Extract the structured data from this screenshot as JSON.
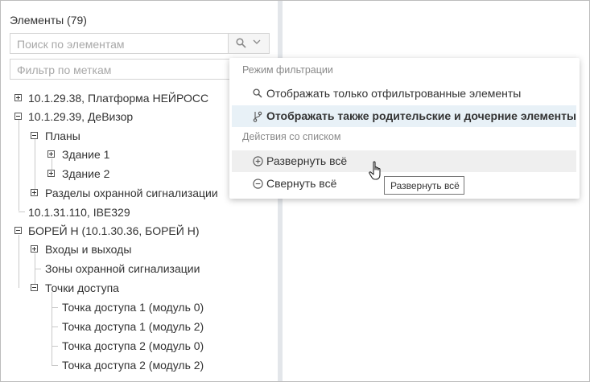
{
  "panel": {
    "header": "Элементы (79)",
    "search_placeholder": "Поиск по элементам",
    "filter_placeholder": "Фильтр по меткам"
  },
  "tree": {
    "n1": "10.1.29.38, Платформа НЕЙРОСС",
    "n2": "10.1.29.39, ДеВизор",
    "n3": "Планы",
    "n4": "Здание 1",
    "n5": "Здание 2",
    "n6": "Разделы охранной сигнализации",
    "n7": "10.1.31.110, IBE329",
    "n8": "БОРЕЙ Н (10.1.30.36, БОРЕЙ Н)",
    "n9": "Входы и выходы",
    "n10": "Зоны охранной сигнализации",
    "n11": "Точки доступа",
    "n12": "Точка доступа 1 (модуль 0)",
    "n13": "Точка доступа 1 (модуль 2)",
    "n14": "Точка доступа 2 (модуль 0)",
    "n15": "Точка доступа 2 (модуль 2)"
  },
  "menu": {
    "section_filter": "Режим фильтрации",
    "item_only_filtered": "Отображать только отфильтрованные элементы",
    "item_parent_child": "Отображать также родительские и дочерние элементы",
    "section_actions": "Действия со списком",
    "item_expand_all": "Развернуть всё",
    "item_collapse_all": "Свернуть всё"
  },
  "tooltip": "Развернуть всё",
  "colors": {
    "selected_bg": "#e8f1f7",
    "hover_bg": "#efefef",
    "splitter": "#e3e6ea"
  },
  "icons": [
    "search-icon",
    "chevron-down-icon",
    "branch-icon",
    "plus-circle-icon",
    "minus-circle-icon",
    "hand-cursor-icon"
  ]
}
